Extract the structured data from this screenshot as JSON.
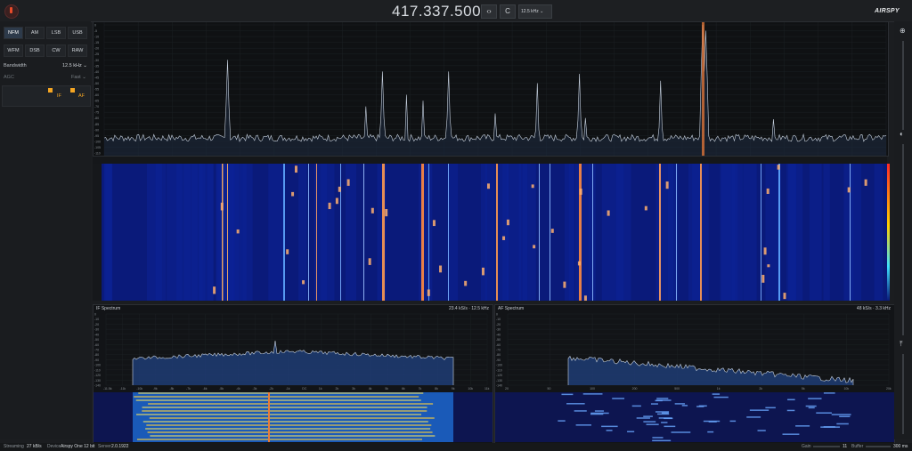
{
  "header": {
    "frequency": "417.337.500",
    "swap_label": "‹›",
    "center_label": "C",
    "step": "12.5 kHz",
    "logo": "AIRSPY"
  },
  "left_panel": {
    "modes": [
      "NFM",
      "AM",
      "LSB",
      "USB",
      "WFM",
      "DSB",
      "CW",
      "RAW"
    ],
    "selected_mode": "NFM",
    "bandwidth_label": "Bandwidth",
    "bandwidth_value": "12.5 kHz",
    "agc_label": "AGC",
    "agc_value": "Fast",
    "if_label": "IF",
    "af_label": "AF"
  },
  "spectrum": {
    "db_ticks": [
      "0",
      "-5",
      "-10",
      "-15",
      "-20",
      "-25",
      "-30",
      "-35",
      "-40",
      "-45",
      "-50",
      "-55",
      "-60",
      "-65",
      "-70",
      "-75",
      "-80",
      "-85",
      "-90",
      "-95",
      "-100",
      "-105",
      "-110"
    ],
    "freq_ticks": [
      "415.000",
      "415.200",
      "415.400",
      "415.600",
      "415.800",
      "416.000",
      "416.200",
      "416.400",
      "416.600",
      "416.800",
      "417.000",
      "417.200",
      "417.400",
      "417.600",
      "417.800",
      "418.000",
      "418.200",
      "418.400",
      "418.600",
      "418.800"
    ]
  },
  "if_spectrum": {
    "title": "IF Spectrum",
    "info": "23.4 kS/s · 12.5 kHz",
    "db_ticks": [
      "0",
      "-10",
      "-20",
      "-30",
      "-40",
      "-50",
      "-60",
      "-70",
      "-80",
      "-90",
      "-100",
      "-110",
      "-120",
      "-130",
      "-140"
    ],
    "freq_ticks": [
      "-11.5k",
      "-11k",
      "-10k",
      "-9k",
      "-8k",
      "-7k",
      "-6k",
      "-5k",
      "-4k",
      "-3k",
      "-2k",
      "-1k",
      "DC",
      "1k",
      "2k",
      "3k",
      "4k",
      "5k",
      "6k",
      "7k",
      "8k",
      "9k",
      "10k",
      "11k"
    ]
  },
  "af_spectrum": {
    "title": "AF Spectrum",
    "info": "48 kS/s · 3.3 kHz",
    "db_ticks": [
      "0",
      "-10",
      "-20",
      "-30",
      "-40",
      "-50",
      "-60",
      "-70",
      "-80",
      "-90",
      "-100",
      "-110",
      "-120",
      "-130",
      "-140"
    ],
    "freq_ticks": [
      "20",
      "50",
      "100",
      "200",
      "500",
      "1k",
      "2k",
      "5k",
      "10k",
      "20k"
    ]
  },
  "status": {
    "streaming_label": "Streaming",
    "streaming_value": "27 kB/s",
    "device_label": "Device",
    "device_value": "Airspy One 12 bit",
    "server_label": "Server",
    "server_value": "2.0.1922",
    "gain_label": "Gain",
    "gain_value": "11",
    "buffer_label": "Buffer",
    "buffer_value": "300 ms"
  },
  "colors": {
    "accent": "#f5a623",
    "waterfall_bg": "#0a1a7a",
    "trace": "#c9d3e0",
    "marker": "#e87a3a"
  }
}
